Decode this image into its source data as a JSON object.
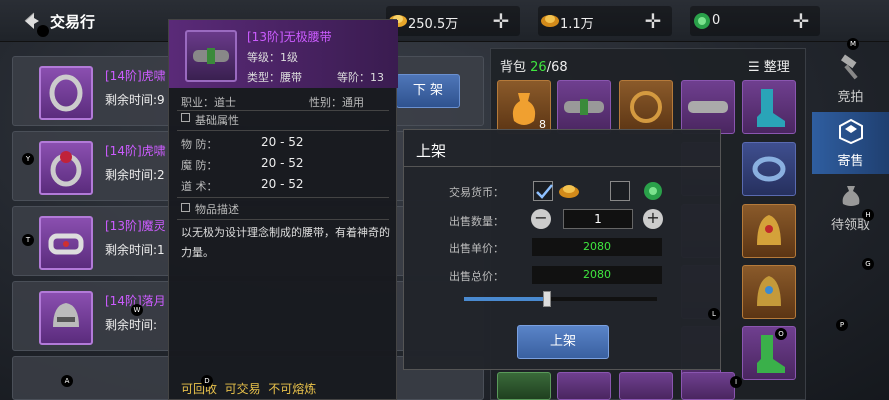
{
  "header": {
    "title": "交易行",
    "currencies": [
      {
        "icon": "gold-ingot-icon",
        "value": "250.5万"
      },
      {
        "icon": "gold-coin-icon",
        "value": "1.1万"
      },
      {
        "icon": "jade-coin-icon",
        "value": "0"
      }
    ]
  },
  "list": [
    {
      "name": "[14阶]虎啸",
      "time": "剩余时间:9"
    },
    {
      "name": "[14阶]虎啸",
      "time": "剩余时间:2"
    },
    {
      "name": "[13阶]魔灵",
      "time": "剩余时间:1"
    },
    {
      "name": "[14阶]落月",
      "time": "剩余时间:"
    }
  ],
  "list_button": "下 架",
  "tooltip": {
    "name": "[13阶]无极腰带",
    "level": "等级：1级",
    "type": "类型：腰带",
    "grade": "等阶：13",
    "job": "职业：道士",
    "gender": "性别：通用",
    "base_header": "基础属性",
    "stats": [
      {
        "label": "物 防：",
        "value": "20 - 52"
      },
      {
        "label": "魔 防：",
        "value": "20 - 52"
      },
      {
        "label": "道 术：",
        "value": "20 - 52"
      }
    ],
    "desc_header": "物品描述",
    "desc": "以无极为设计理念制成的腰带，有着神奇的力量。",
    "footer": "可回收  可交易  不可熔炼"
  },
  "dialog": {
    "title": "上架",
    "currency_label": "交易货币：",
    "qty_label": "出售数量：",
    "qty_value": "1",
    "unit_label": "出售单价：",
    "unit_value": "2080",
    "total_label": "出售总价：",
    "total_value": "2080",
    "slider_fraction": 0.43,
    "confirm": "上架"
  },
  "bag": {
    "label": "背包",
    "used": "26",
    "total": "/68",
    "sort": "整理",
    "first_count": "8"
  },
  "side_tabs": [
    {
      "label": "竞拍",
      "icon": "hammer-icon"
    },
    {
      "label": "寄售",
      "icon": "chest-icon"
    },
    {
      "label": "待领取",
      "icon": "moneybag-icon"
    }
  ],
  "debug_dots": [
    "M",
    "Y",
    "T",
    "W",
    "A",
    "D",
    "H",
    "G",
    "L",
    "P",
    "O",
    "I"
  ]
}
